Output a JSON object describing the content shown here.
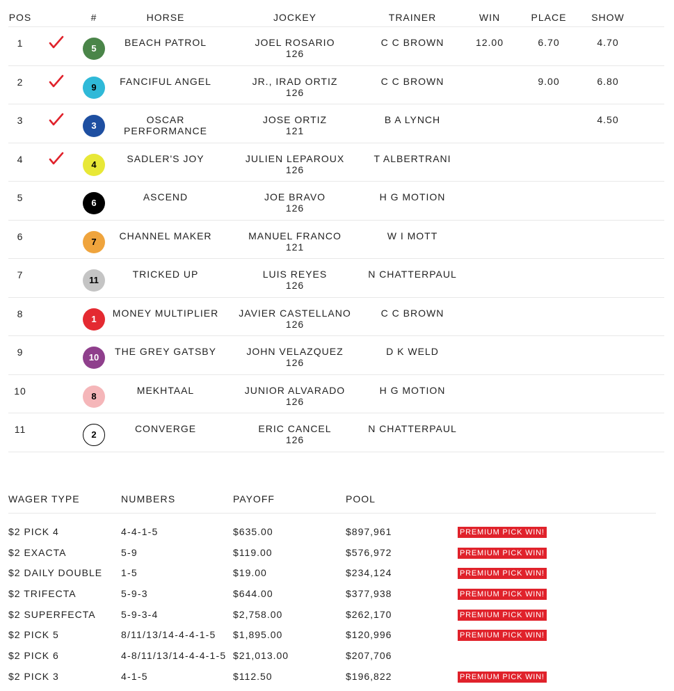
{
  "results": {
    "headers": {
      "pos": "POS",
      "num": "#",
      "horse": "HORSE",
      "jockey": "JOCKEY",
      "trainer": "TRAINER",
      "win": "WIN",
      "place": "PLACE",
      "show": "SHOW"
    },
    "rows": [
      {
        "pos": "1",
        "checked": true,
        "num": "5",
        "badge_bg": "#4a8549",
        "badge_fg": "#ffffff",
        "horse": "BEACH PATROL",
        "jockey": "JOEL ROSARIO",
        "weight": "126",
        "trainer": "C C BROWN",
        "win": "12.00",
        "place": "6.70",
        "show": "4.70"
      },
      {
        "pos": "2",
        "checked": true,
        "num": "9",
        "badge_bg": "#2fb9d8",
        "badge_fg": "#000000",
        "horse": "FANCIFUL ANGEL",
        "jockey": "JR., IRAD ORTIZ",
        "weight": "126",
        "trainer": "C C BROWN",
        "win": "",
        "place": "9.00",
        "show": "6.80"
      },
      {
        "pos": "3",
        "checked": true,
        "num": "3",
        "badge_bg": "#1e4fa1",
        "badge_fg": "#ffffff",
        "horse": "OSCAR PERFORMANCE",
        "jockey": "JOSE ORTIZ",
        "weight": "121",
        "trainer": "B A LYNCH",
        "win": "",
        "place": "",
        "show": "4.50"
      },
      {
        "pos": "4",
        "checked": true,
        "num": "4",
        "badge_bg": "#e8e837",
        "badge_fg": "#000000",
        "horse": "SADLER'S JOY",
        "jockey": "JULIEN LEPAROUX",
        "weight": "126",
        "trainer": "T ALBERTRANI",
        "win": "",
        "place": "",
        "show": ""
      },
      {
        "pos": "5",
        "checked": false,
        "num": "6",
        "badge_bg": "#000000",
        "badge_fg": "#ffffff",
        "horse": "ASCEND",
        "jockey": "JOE BRAVO",
        "weight": "126",
        "trainer": "H G MOTION",
        "win": "",
        "place": "",
        "show": ""
      },
      {
        "pos": "6",
        "checked": false,
        "num": "7",
        "badge_bg": "#efa43d",
        "badge_fg": "#000000",
        "horse": "CHANNEL MAKER",
        "jockey": "MANUEL FRANCO",
        "weight": "121",
        "trainer": "W I MOTT",
        "win": "",
        "place": "",
        "show": ""
      },
      {
        "pos": "7",
        "checked": false,
        "num": "11",
        "badge_bg": "#c4c4c4",
        "badge_fg": "#000000",
        "horse": "TRICKED UP",
        "jockey": "LUIS REYES",
        "weight": "126",
        "trainer": "N CHATTERPAUL",
        "win": "",
        "place": "",
        "show": ""
      },
      {
        "pos": "8",
        "checked": false,
        "num": "1",
        "badge_bg": "#e42a31",
        "badge_fg": "#ffffff",
        "horse": "MONEY MULTIPLIER",
        "jockey": "JAVIER CASTELLANO",
        "weight": "126",
        "trainer": "C C BROWN",
        "win": "",
        "place": "",
        "show": ""
      },
      {
        "pos": "9",
        "checked": false,
        "num": "10",
        "badge_bg": "#8f3f8c",
        "badge_fg": "#ffffff",
        "horse": "THE GREY GATSBY",
        "jockey": "JOHN VELAZQUEZ",
        "weight": "126",
        "trainer": "D K WELD",
        "win": "",
        "place": "",
        "show": ""
      },
      {
        "pos": "10",
        "checked": false,
        "num": "8",
        "badge_bg": "#f5b6b9",
        "badge_fg": "#000000",
        "horse": "MEKHTAAL",
        "jockey": "JUNIOR ALVARADO",
        "weight": "126",
        "trainer": "H G MOTION",
        "win": "",
        "place": "",
        "show": ""
      },
      {
        "pos": "11",
        "checked": false,
        "num": "2",
        "badge_bg": "#ffffff",
        "badge_fg": "#000000",
        "horse": "CONVERGE",
        "jockey": "ERIC CANCEL",
        "weight": "126",
        "trainer": "N CHATTERPAUL",
        "win": "",
        "place": "",
        "show": ""
      }
    ]
  },
  "wagers": {
    "headers": {
      "type": "WAGER TYPE",
      "numbers": "NUMBERS",
      "payoff": "PAYOFF",
      "pool": "POOL"
    },
    "rows": [
      {
        "type": "$2 PICK 4",
        "numbers": "4-4-1-5",
        "payoff": "$635.00",
        "pool": "$897,961",
        "tag": "PREMIUM PICK WIN!"
      },
      {
        "type": "$2 EXACTA",
        "numbers": "5-9",
        "payoff": "$119.00",
        "pool": "$576,972",
        "tag": "PREMIUM PICK WIN!"
      },
      {
        "type": "$2 DAILY DOUBLE",
        "numbers": "1-5",
        "payoff": "$19.00",
        "pool": "$234,124",
        "tag": "PREMIUM PICK WIN!"
      },
      {
        "type": "$2 TRIFECTA",
        "numbers": "5-9-3",
        "payoff": "$644.00",
        "pool": "$377,938",
        "tag": "PREMIUM PICK WIN!"
      },
      {
        "type": "$2 SUPERFECTA",
        "numbers": "5-9-3-4",
        "payoff": "$2,758.00",
        "pool": "$262,170",
        "tag": "PREMIUM PICK WIN!"
      },
      {
        "type": "$2 PICK 5",
        "numbers": "8/11/13/14-4-4-1-5",
        "payoff": "$1,895.00",
        "pool": "$120,996",
        "tag": "PREMIUM PICK WIN!"
      },
      {
        "type": "$2 PICK 6",
        "numbers": "4-8/11/13/14-4-4-1-5",
        "payoff": "$21,013.00",
        "pool": "$207,706",
        "tag": ""
      },
      {
        "type": "$2 PICK 3",
        "numbers": "4-1-5",
        "payoff": "$112.50",
        "pool": "$196,822",
        "tag": "PREMIUM PICK WIN!"
      }
    ]
  },
  "colors": {
    "check": "#e0222b",
    "tag_bg": "#e0222b",
    "divider": "#e8e8e8"
  }
}
